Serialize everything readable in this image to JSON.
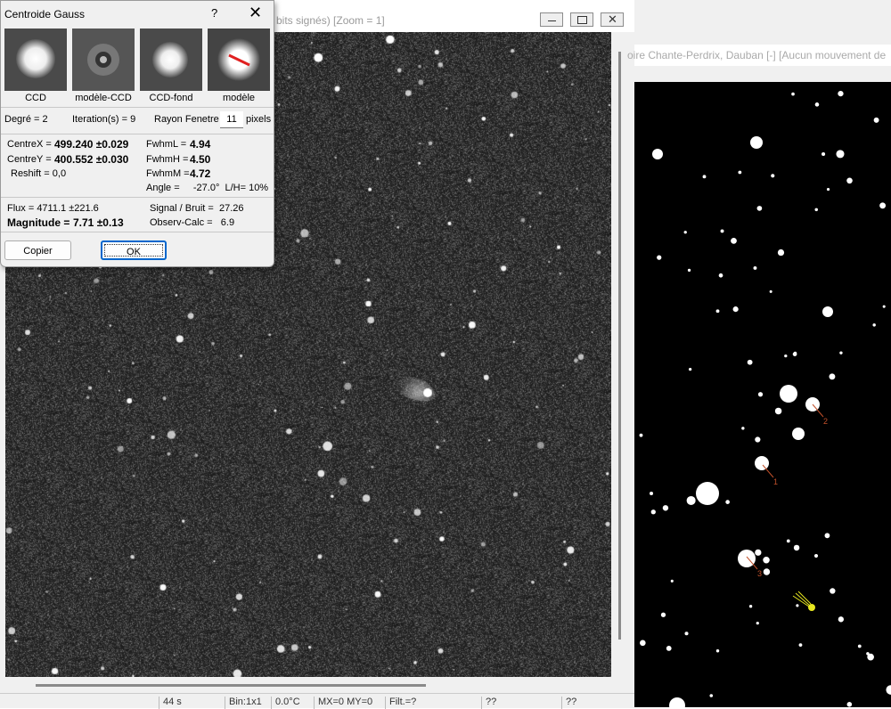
{
  "image_window": {
    "title": "bits signés)   [Zoom = 1]",
    "status": [
      "44 s",
      "Bin:1x1",
      "0.0°C",
      "MX=0 MY=0",
      "Filt.=?",
      "??",
      "??"
    ]
  },
  "map_window": {
    "title": "oire Chante-Perdrix, Dauban [-] [Aucun mouvement de"
  },
  "map_labels": [
    "1",
    "2",
    "3"
  ],
  "dialog": {
    "title": "Centroide Gauss",
    "help": "?",
    "close": "✕",
    "thumbnails": [
      "CCD",
      "modèle-CCD",
      "CCD-fond",
      "modèle"
    ],
    "degree": "Degré = 2",
    "iterations": "Iteration(s) = 9",
    "window_label": "Rayon Fenetre",
    "window_value": "11",
    "window_unit": "pixels",
    "centrex_label": "CentreX =",
    "centrex_value": "499.240 ±0.029",
    "centrey_label": "CentreY =",
    "centrey_value": "400.552 ±0.030",
    "reshift": "Reshift =  0,0",
    "fwhml_label": "FwhmL =",
    "fwhml_value": "4.94",
    "fwhmh_label": "FwhmH =",
    "fwhmh_value": "4.50",
    "fwhmm_label": "FwhmM =",
    "fwhmm_value": "4.72",
    "angle": "Angle =     -27.0°  L/H= 10%",
    "flux": "Flux = 4711.1 ±221.6",
    "magnitude_label": "Magnitude =",
    "magnitude_value": "7.71 ±0.13",
    "signal": "Signal / Bruit =  27.26",
    "observ": "Observ-Calc =   6.9",
    "copy_label": "Copier",
    "ok_label": "OK"
  }
}
